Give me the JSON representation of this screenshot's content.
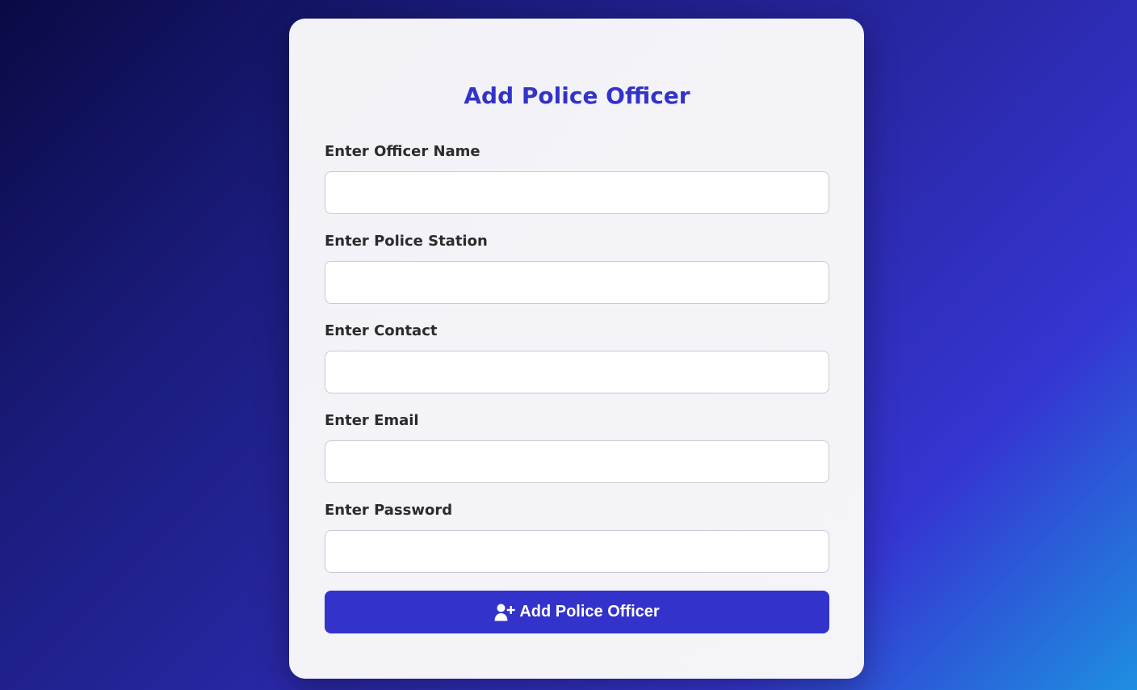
{
  "page": {
    "title": "Add Police Officer"
  },
  "form": {
    "fields": [
      {
        "label": "Enter Officer Name",
        "value": "",
        "placeholder": ""
      },
      {
        "label": "Enter Police Station",
        "value": "",
        "placeholder": ""
      },
      {
        "label": "Enter Contact",
        "value": "",
        "placeholder": ""
      },
      {
        "label": "Enter Email",
        "value": "",
        "placeholder": ""
      },
      {
        "label": "Enter Password",
        "value": "",
        "placeholder": ""
      }
    ],
    "submit": {
      "label": "Add Police Officer",
      "icon": "user-plus-icon"
    }
  },
  "colors": {
    "accent": "#3333cc",
    "title": "#3333c8",
    "label": "#2b2b2b",
    "card": "#f3f3f8"
  }
}
